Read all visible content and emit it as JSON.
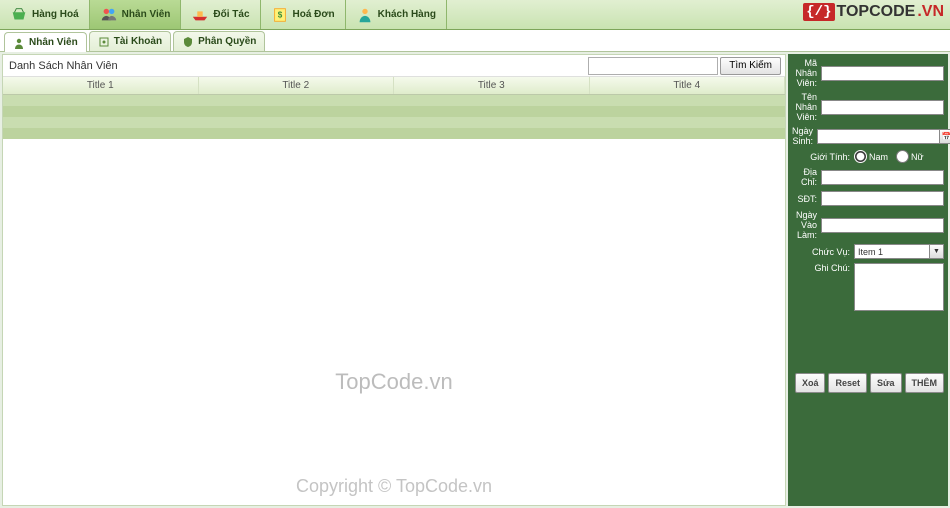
{
  "toolbar": {
    "items": [
      {
        "label": "Hàng Hoá"
      },
      {
        "label": "Nhân Viên"
      },
      {
        "label": "Đối Tác"
      },
      {
        "label": "Hoá Đơn"
      },
      {
        "label": "Khách Hàng"
      }
    ]
  },
  "logo": {
    "bracket": "{/}",
    "text": "TOPCODE",
    "suffix": ".VN"
  },
  "subtabs": [
    {
      "label": "Nhân Viên"
    },
    {
      "label": "Tài Khoản"
    },
    {
      "label": "Phân Quyền"
    }
  ],
  "list": {
    "title": "Danh Sách Nhân Viên",
    "search_placeholder": "",
    "search_btn": "Tìm Kiếm",
    "columns": [
      "Title 1",
      "Title 2",
      "Title 3",
      "Title 4"
    ]
  },
  "watermarks": {
    "center": "TopCode.vn",
    "bottom": "Copyright © TopCode.vn"
  },
  "form": {
    "maNV": {
      "label": "Mã Nhân Viên:",
      "value": ""
    },
    "tenNV": {
      "label": "Tên Nhân Viên:",
      "value": ""
    },
    "ngaySinh": {
      "label": "Ngày Sinh:",
      "value": ""
    },
    "gioiTinh": {
      "label": "Giới Tính:",
      "nam": "Nam",
      "nu": "Nữ"
    },
    "diaChi": {
      "label": "Địa Chỉ:",
      "value": ""
    },
    "sdt": {
      "label": "SĐT:",
      "value": ""
    },
    "ngayVaoLam": {
      "label": "Ngày Vào Làm:",
      "value": ""
    },
    "chucVu": {
      "label": "Chức Vụ:",
      "value": "Item 1"
    },
    "ghiChu": {
      "label": "Ghi Chú:",
      "value": ""
    },
    "buttons": {
      "xoa": "Xoá",
      "reset": "Reset",
      "sua": "Sửa",
      "them": "THÊM"
    }
  }
}
